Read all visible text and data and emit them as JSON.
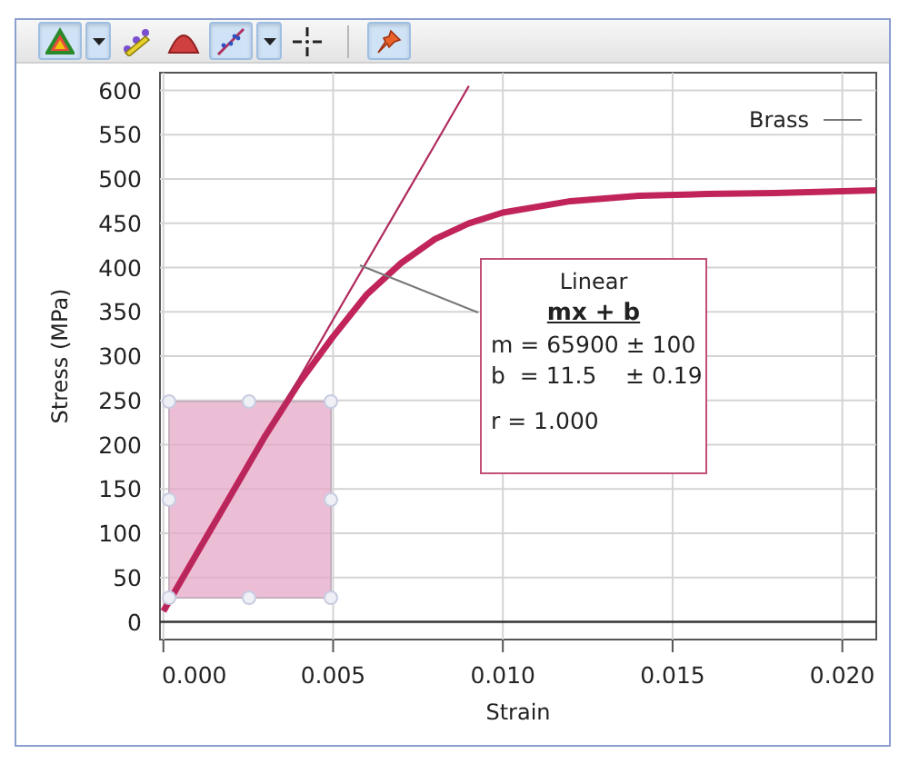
{
  "toolbar": [
    {
      "kind": "button",
      "selected": true
    },
    {
      "kind": "dropdown",
      "selected": true
    },
    {
      "kind": "button",
      "selected": false
    },
    {
      "kind": "button",
      "selected": false
    },
    {
      "kind": "button",
      "selected": true
    },
    {
      "kind": "dropdown",
      "selected": true
    },
    {
      "kind": "button",
      "selected": false
    },
    {
      "kind": "separator"
    },
    {
      "kind": "button",
      "selected": true
    }
  ],
  "chart": {
    "chart_data": {
      "type": "line",
      "xlabel": "Strain",
      "ylabel": "Stress (MPa)",
      "grid": true,
      "x": [
        0,
        0.001,
        0.002,
        0.003,
        0.004,
        0.005,
        0.006,
        0.007,
        0.008,
        0.009,
        0.01,
        0.012,
        0.014,
        0.016,
        0.018,
        0.02,
        0.021
      ],
      "series": [
        {
          "name": "Brass",
          "color": "#c0245a",
          "values": [
            12,
            78,
            144,
            210,
            270,
            322,
            370,
            405,
            432,
            450,
            462,
            475,
            481,
            483,
            484,
            486,
            487
          ]
        },
        {
          "name": "Linear",
          "color": "#b02a5e",
          "values": [
            12,
            77,
            143,
            209,
            275,
            341,
            407,
            473,
            539,
            605,
            null,
            null,
            null,
            null,
            null,
            null,
            null
          ]
        }
      ],
      "xlim": [
        -0.0001,
        0.021
      ],
      "ylim": [
        -20,
        620
      ],
      "xticks": [
        {
          "value": 0,
          "label": "0.000"
        },
        {
          "value": 0.005,
          "label": "0.005"
        },
        {
          "value": 0.01,
          "label": "0.010"
        },
        {
          "value": 0.015,
          "label": "0.015"
        },
        {
          "value": 0.02,
          "label": "0.020"
        }
      ],
      "yticks": [
        0,
        50,
        100,
        150,
        200,
        250,
        300,
        350,
        400,
        450,
        500,
        550,
        600
      ]
    },
    "fit_box": {
      "lines": [
        {
          "kind": "formula",
          "text": "mx + b"
        },
        {
          "kind": "param",
          "text": "m = 65900 ± 100"
        },
        {
          "kind": "param",
          "text": "b  = 11.5    ± 0.19"
        },
        {
          "kind": "gap",
          "text": "r = 1.000"
        }
      ]
    }
  }
}
